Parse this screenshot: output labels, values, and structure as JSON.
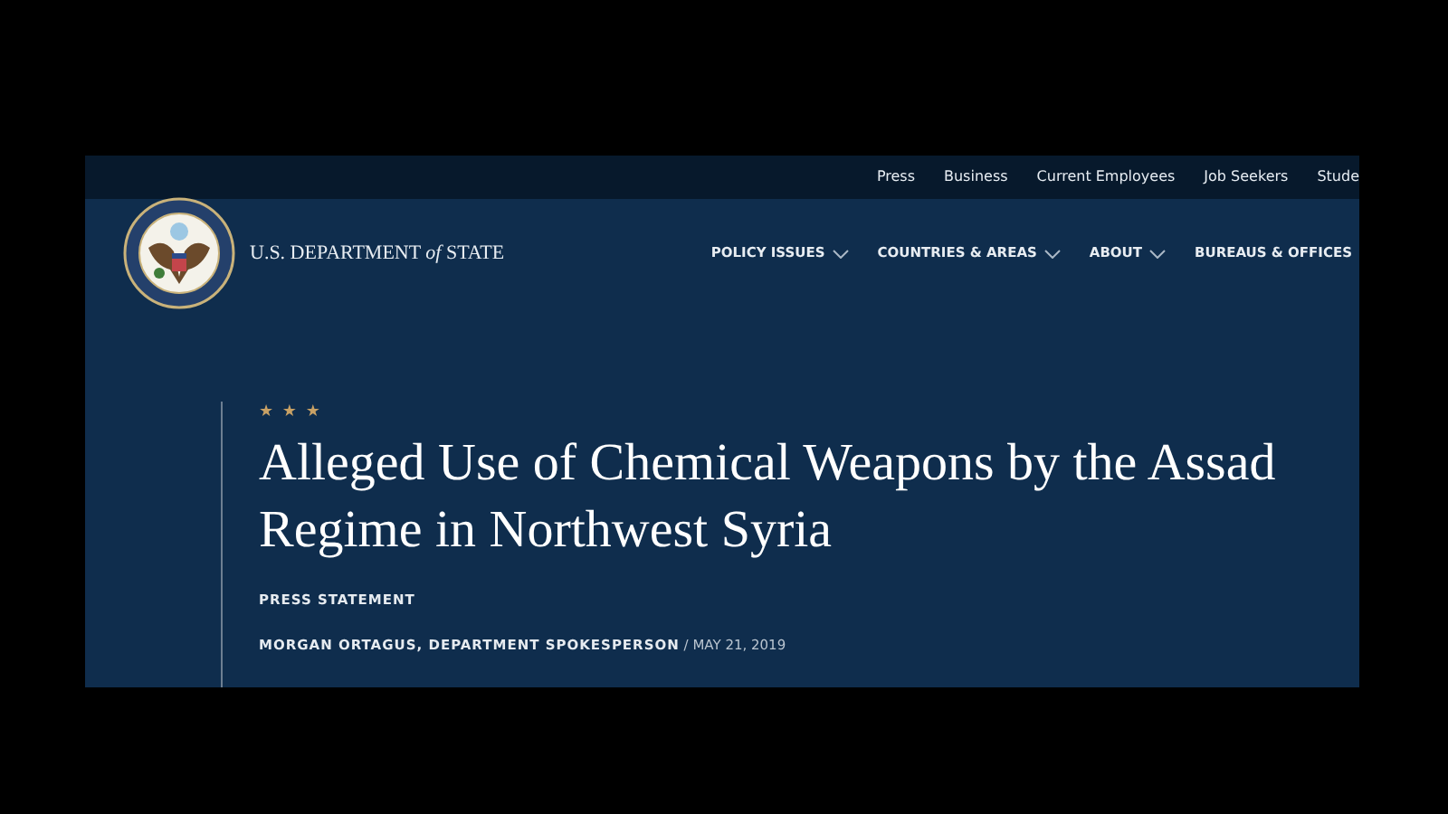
{
  "utility_links": [
    "Press",
    "Business",
    "Current Employees",
    "Job Seekers",
    "Stude"
  ],
  "brand": {
    "text_before": "U.S. DEPARTMENT ",
    "text_italic": "of",
    "text_after": " STATE"
  },
  "nav": [
    {
      "label": "POLICY ISSUES",
      "dropdown": true
    },
    {
      "label": "COUNTRIES & AREAS",
      "dropdown": true
    },
    {
      "label": "ABOUT",
      "dropdown": true
    },
    {
      "label": "BUREAUS & OFFICES",
      "dropdown": false
    }
  ],
  "article": {
    "stars": "★ ★ ★",
    "title": "Alleged Use of Chemical Weapons by the Assad Regime in Northwest Syria",
    "type": "PRESS STATEMENT",
    "author": "MORGAN ORTAGUS, DEPARTMENT SPOKESPERSON",
    "separator": "/",
    "date": "MAY 21, 2019"
  }
}
